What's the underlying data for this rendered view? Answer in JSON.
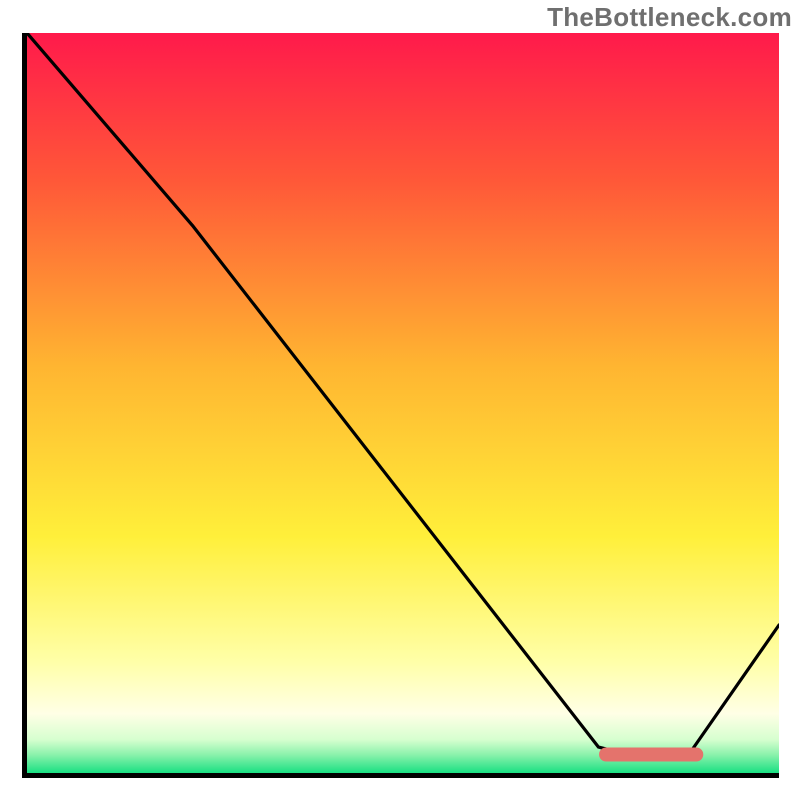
{
  "watermark": {
    "text": "TheBottleneck.com"
  },
  "chart_data": {
    "type": "line",
    "title": "",
    "xlabel": "",
    "ylabel": "",
    "xlim": [
      0,
      100
    ],
    "ylim": [
      0,
      100
    ],
    "grid": false,
    "legend": false,
    "background_gradient": {
      "stops": [
        {
          "pos": 0.0,
          "color": "#ff1a4b"
        },
        {
          "pos": 0.2,
          "color": "#ff5838"
        },
        {
          "pos": 0.45,
          "color": "#ffb531"
        },
        {
          "pos": 0.68,
          "color": "#ffef3a"
        },
        {
          "pos": 0.85,
          "color": "#ffffa8"
        },
        {
          "pos": 0.92,
          "color": "#ffffe6"
        },
        {
          "pos": 0.955,
          "color": "#d6ffcf"
        },
        {
          "pos": 0.975,
          "color": "#8cf2ac"
        },
        {
          "pos": 1.0,
          "color": "#19e082"
        }
      ]
    },
    "series": [
      {
        "name": "bottleneck-curve",
        "x": [
          0,
          22,
          76,
          80,
          88,
          100
        ],
        "y": [
          100,
          74,
          3.5,
          2.5,
          2.5,
          20
        ]
      }
    ],
    "marker": {
      "name": "optimal-range",
      "x_range": [
        77,
        89
      ],
      "y": 2.5,
      "color": "#e4736c"
    }
  }
}
